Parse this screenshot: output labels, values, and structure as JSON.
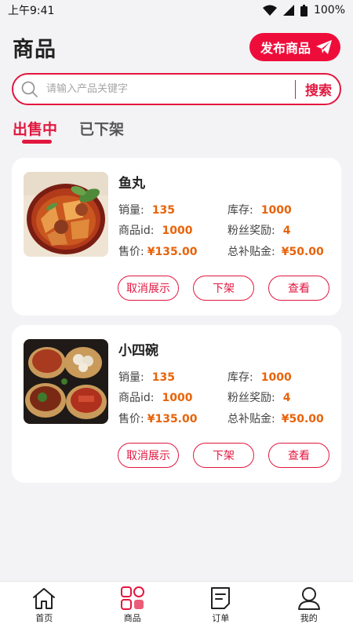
{
  "status_bar": {
    "time": "上午9:41",
    "battery": "100%"
  },
  "header": {
    "title": "商品",
    "publish_label": "发布商品"
  },
  "search": {
    "placeholder": "请输入产品关键字",
    "button_label": "搜索"
  },
  "tabs": [
    {
      "label": "出售中",
      "active": true
    },
    {
      "label": "已下架",
      "active": false
    }
  ],
  "products": [
    {
      "name": "鱼丸",
      "image": "braised-fish-ball-dish",
      "sales_label": "销量:",
      "sales": "135",
      "stock_label": "库存:",
      "stock": "1000",
      "id_label": "商品id:",
      "id": "1000",
      "fan_reward_label": "粉丝奖励:",
      "fan_reward": "4",
      "price_label": "售价:",
      "price": "¥135.00",
      "subsidy_label": "总补贴金:",
      "subsidy": "¥50.00",
      "actions": {
        "cancel_display": "取消展示",
        "delist": "下架",
        "view": "查看"
      }
    },
    {
      "name": "小四碗",
      "image": "four-bowl-dishes",
      "sales_label": "销量:",
      "sales": "135",
      "stock_label": "库存:",
      "stock": "1000",
      "id_label": "商品id:",
      "id": "1000",
      "fan_reward_label": "粉丝奖励:",
      "fan_reward": "4",
      "price_label": "售价:",
      "price": "¥135.00",
      "subsidy_label": "总补贴金:",
      "subsidy": "¥50.00",
      "actions": {
        "cancel_display": "取消展示",
        "delist": "下架",
        "view": "查看"
      }
    }
  ],
  "bottom_nav": [
    {
      "label": "首页",
      "icon": "home-icon",
      "active": false
    },
    {
      "label": "商品",
      "icon": "grid-icon",
      "active": true
    },
    {
      "label": "订单",
      "icon": "order-icon",
      "active": false
    },
    {
      "label": "我的",
      "icon": "user-icon",
      "active": false
    }
  ],
  "colors": {
    "accent": "#e2173f",
    "value": "#e8630a",
    "background": "#f3f3f5"
  }
}
